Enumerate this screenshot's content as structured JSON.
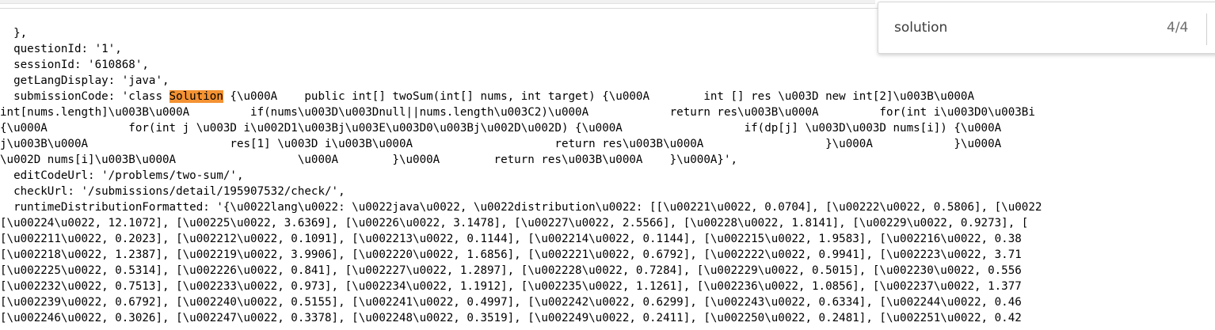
{
  "find_bar": {
    "query": "solution",
    "match_count": "4/4"
  },
  "source": {
    "lines": [
      "  },",
      "  questionId: '1',",
      "  sessionId: '610868',",
      "  getLangDisplay: 'java',",
      "  submissionCode: 'class ",
      "int[nums.length]\\u003B\\u000A         if(nums\\u003D\\u003Dnull||nums.length\\u003C2)\\u000A            return res\\u003B\\u000A         for(int i\\u003D0\\u003Bi",
      "{\\u000A            for(int j \\u003D i\\u002D1\\u003Bj\\u003E\\u003D0\\u003Bj\\u002D\\u002D) {\\u000A                  if(dp[j] \\u003D\\u003D nums[i]) {\\u000A",
      "j\\u003B\\u000A                     res[1] \\u003D i\\u003B\\u000A                     return res\\u003B\\u000A                  }\\u000A            }\\u000A",
      "\\u002D nums[i]\\u003B\\u000A                  \\u000A        }\\u000A        return res\\u003B\\u000A    }\\u000A}',",
      "  editCodeUrl: '/problems/two-sum/',",
      "  checkUrl: '/submissions/detail/195907532/check/',",
      "  runtimeDistributionFormatted: '{\\u0022lang\\u0022: \\u0022java\\u0022, \\u0022distribution\\u0022: [[\\u00221\\u0022, 0.0704], [\\u00222\\u0022, 0.5806], [\\u0022",
      "[\\u00224\\u0022, 12.1072], [\\u00225\\u0022, 3.6369], [\\u00226\\u0022, 3.1478], [\\u00227\\u0022, 2.5566], [\\u00228\\u0022, 1.8141], [\\u00229\\u0022, 0.9273], [",
      "[\\u002211\\u0022, 0.2023], [\\u002212\\u0022, 0.1091], [\\u002213\\u0022, 0.1144], [\\u002214\\u0022, 0.1144], [\\u002215\\u0022, 1.9583], [\\u002216\\u0022, 0.38",
      "[\\u002218\\u0022, 1.2387], [\\u002219\\u0022, 3.9906], [\\u002220\\u0022, 1.6856], [\\u002221\\u0022, 0.6792], [\\u002222\\u0022, 0.9941], [\\u002223\\u0022, 3.71",
      "[\\u002225\\u0022, 0.5314], [\\u002226\\u0022, 0.841], [\\u002227\\u0022, 1.2897], [\\u002228\\u0022, 0.7284], [\\u002229\\u0022, 0.5015], [\\u002230\\u0022, 0.556",
      "[\\u002232\\u0022, 0.7513], [\\u002233\\u0022, 0.973], [\\u002234\\u0022, 1.1912], [\\u002235\\u0022, 1.1261], [\\u002236\\u0022, 1.0856], [\\u002237\\u0022, 1.377",
      "[\\u002239\\u0022, 0.6792], [\\u002240\\u0022, 0.5155], [\\u002241\\u0022, 0.4997], [\\u002242\\u0022, 0.6299], [\\u002243\\u0022, 0.6334], [\\u002244\\u0022, 0.46",
      "[\\u002246\\u0022, 0.3026], [\\u002247\\u0022, 0.3378], [\\u002248\\u0022, 0.3519], [\\u002249\\u0022, 0.2411], [\\u002250\\u0022, 0.2481], [\\u002251\\u0022, 0.42"
    ],
    "match_text": "Solution",
    "match_rest": " {\\u000A    public int[] twoSum(int[] nums, int target) {\\u000A        int [] res \\u003D new int[2]\\u003B\\u000A",
    "highlight_color": "#f49232"
  }
}
